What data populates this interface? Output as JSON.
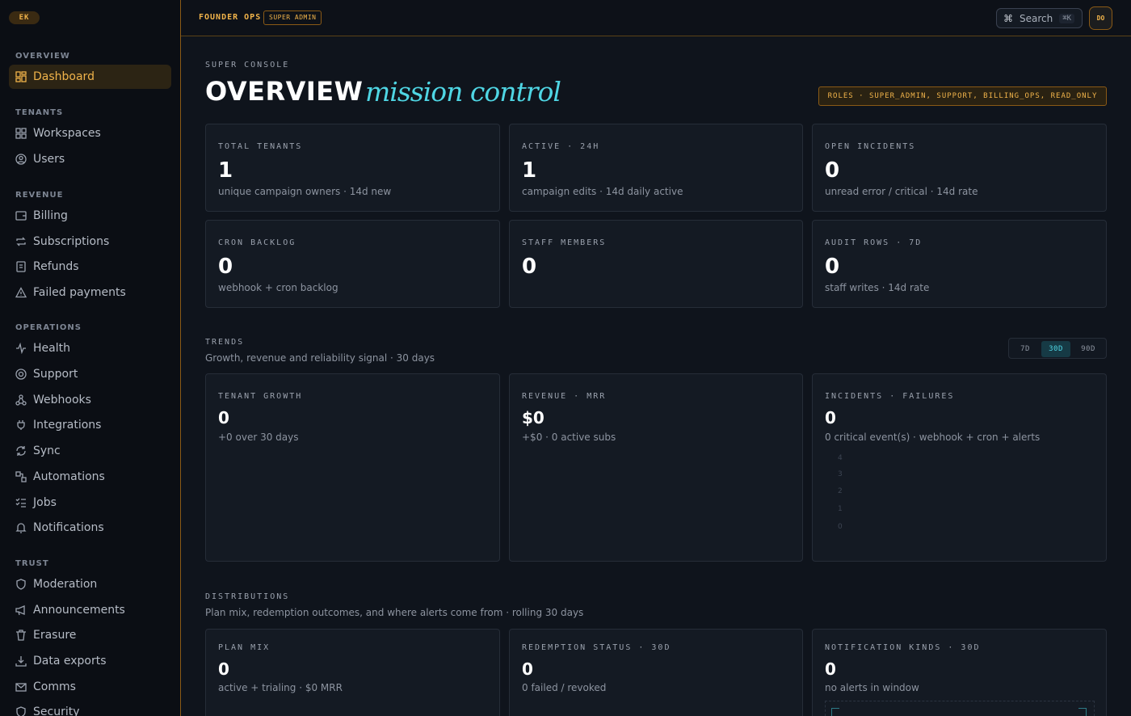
{
  "sidebar": {
    "brand": "EK",
    "sections": [
      {
        "title": "OVERVIEW",
        "items": [
          {
            "label": "Dashboard",
            "icon": "dashboard-icon",
            "active": true
          }
        ]
      },
      {
        "title": "TENANTS",
        "items": [
          {
            "label": "Workspaces",
            "icon": "building-icon"
          },
          {
            "label": "Users",
            "icon": "user-circle-icon"
          }
        ]
      },
      {
        "title": "REVENUE",
        "items": [
          {
            "label": "Billing",
            "icon": "wallet-icon"
          },
          {
            "label": "Subscriptions",
            "icon": "repeat-icon"
          },
          {
            "label": "Refunds",
            "icon": "receipt-icon"
          },
          {
            "label": "Failed payments",
            "icon": "warning-icon"
          }
        ]
      },
      {
        "title": "OPERATIONS",
        "items": [
          {
            "label": "Health",
            "icon": "pulse-icon"
          },
          {
            "label": "Support",
            "icon": "lifebuoy-icon"
          },
          {
            "label": "Webhooks",
            "icon": "webhook-icon"
          },
          {
            "label": "Integrations",
            "icon": "plug-icon"
          },
          {
            "label": "Sync",
            "icon": "refresh-icon"
          },
          {
            "label": "Automations",
            "icon": "workflow-icon"
          },
          {
            "label": "Jobs",
            "icon": "list-check-icon"
          },
          {
            "label": "Notifications",
            "icon": "bell-icon"
          }
        ]
      },
      {
        "title": "TRUST",
        "items": [
          {
            "label": "Moderation",
            "icon": "shield-icon"
          },
          {
            "label": "Announcements",
            "icon": "megaphone-icon"
          },
          {
            "label": "Erasure",
            "icon": "trash-icon"
          },
          {
            "label": "Data exports",
            "icon": "download-icon"
          },
          {
            "label": "Comms",
            "icon": "mail-icon"
          },
          {
            "label": "Security",
            "icon": "shield-check-icon"
          }
        ]
      }
    ]
  },
  "header": {
    "title": "FOUNDER OPS",
    "badge": "SUPER ADMIN",
    "search_label": "Search",
    "search_shortcut": "⌘K",
    "avatar": "DO"
  },
  "main": {
    "eyebrow": "SUPER CONSOLE",
    "title": "OVERVIEW",
    "title_italic": "mission control",
    "roles": "ROLES · SUPER_ADMIN, SUPPORT, BILLING_OPS, READ_ONLY",
    "kpis": [
      {
        "label": "TOTAL TENANTS",
        "value": "1",
        "sub": "unique campaign owners · 14d new"
      },
      {
        "label": "ACTIVE · 24H",
        "value": "1",
        "sub": "campaign edits · 14d daily active"
      },
      {
        "label": "OPEN INCIDENTS",
        "value": "0",
        "sub": "unread error / critical · 14d rate"
      },
      {
        "label": "CRON BACKLOG",
        "value": "0",
        "sub": "webhook + cron backlog"
      },
      {
        "label": "STAFF MEMBERS",
        "value": "0",
        "sub": ""
      },
      {
        "label": "AUDIT ROWS · 7D",
        "value": "0",
        "sub": "staff writes · 14d rate"
      }
    ],
    "trends": {
      "title": "TRENDS",
      "subtitle": "Growth, revenue and reliability signal · 30 days",
      "ranges": [
        "7D",
        "30D",
        "90D"
      ],
      "active_range": "30D",
      "cards": [
        {
          "label": "TENANT GROWTH",
          "value": "0",
          "sub": "+0 over 30 days"
        },
        {
          "label": "REVENUE · MRR",
          "value": "$0",
          "sub": "+$0 · 0 active subs"
        },
        {
          "label": "INCIDENTS · FAILURES",
          "value": "0",
          "sub": "0 critical event(s) · webhook + cron + alerts"
        }
      ],
      "incident_axis_ticks": [
        "4",
        "3",
        "2",
        "1",
        "0"
      ]
    },
    "distributions": {
      "title": "DISTRIBUTIONS",
      "subtitle": "Plan mix, redemption outcomes, and where alerts come from · rolling 30 days",
      "cards": [
        {
          "label": "PLAN MIX",
          "value": "0",
          "sub": "active + trialing · $0 MRR"
        },
        {
          "label": "REDEMPTION STATUS · 30D",
          "value": "0",
          "sub": "0 failed / revoked"
        },
        {
          "label": "NOTIFICATION KINDS · 30D",
          "value": "0",
          "sub": "no alerts in window"
        }
      ]
    }
  },
  "colors": {
    "accent": "#f0b34a",
    "cyan": "#4fd6e4",
    "background": "#0f141c",
    "card": "#141a23"
  }
}
